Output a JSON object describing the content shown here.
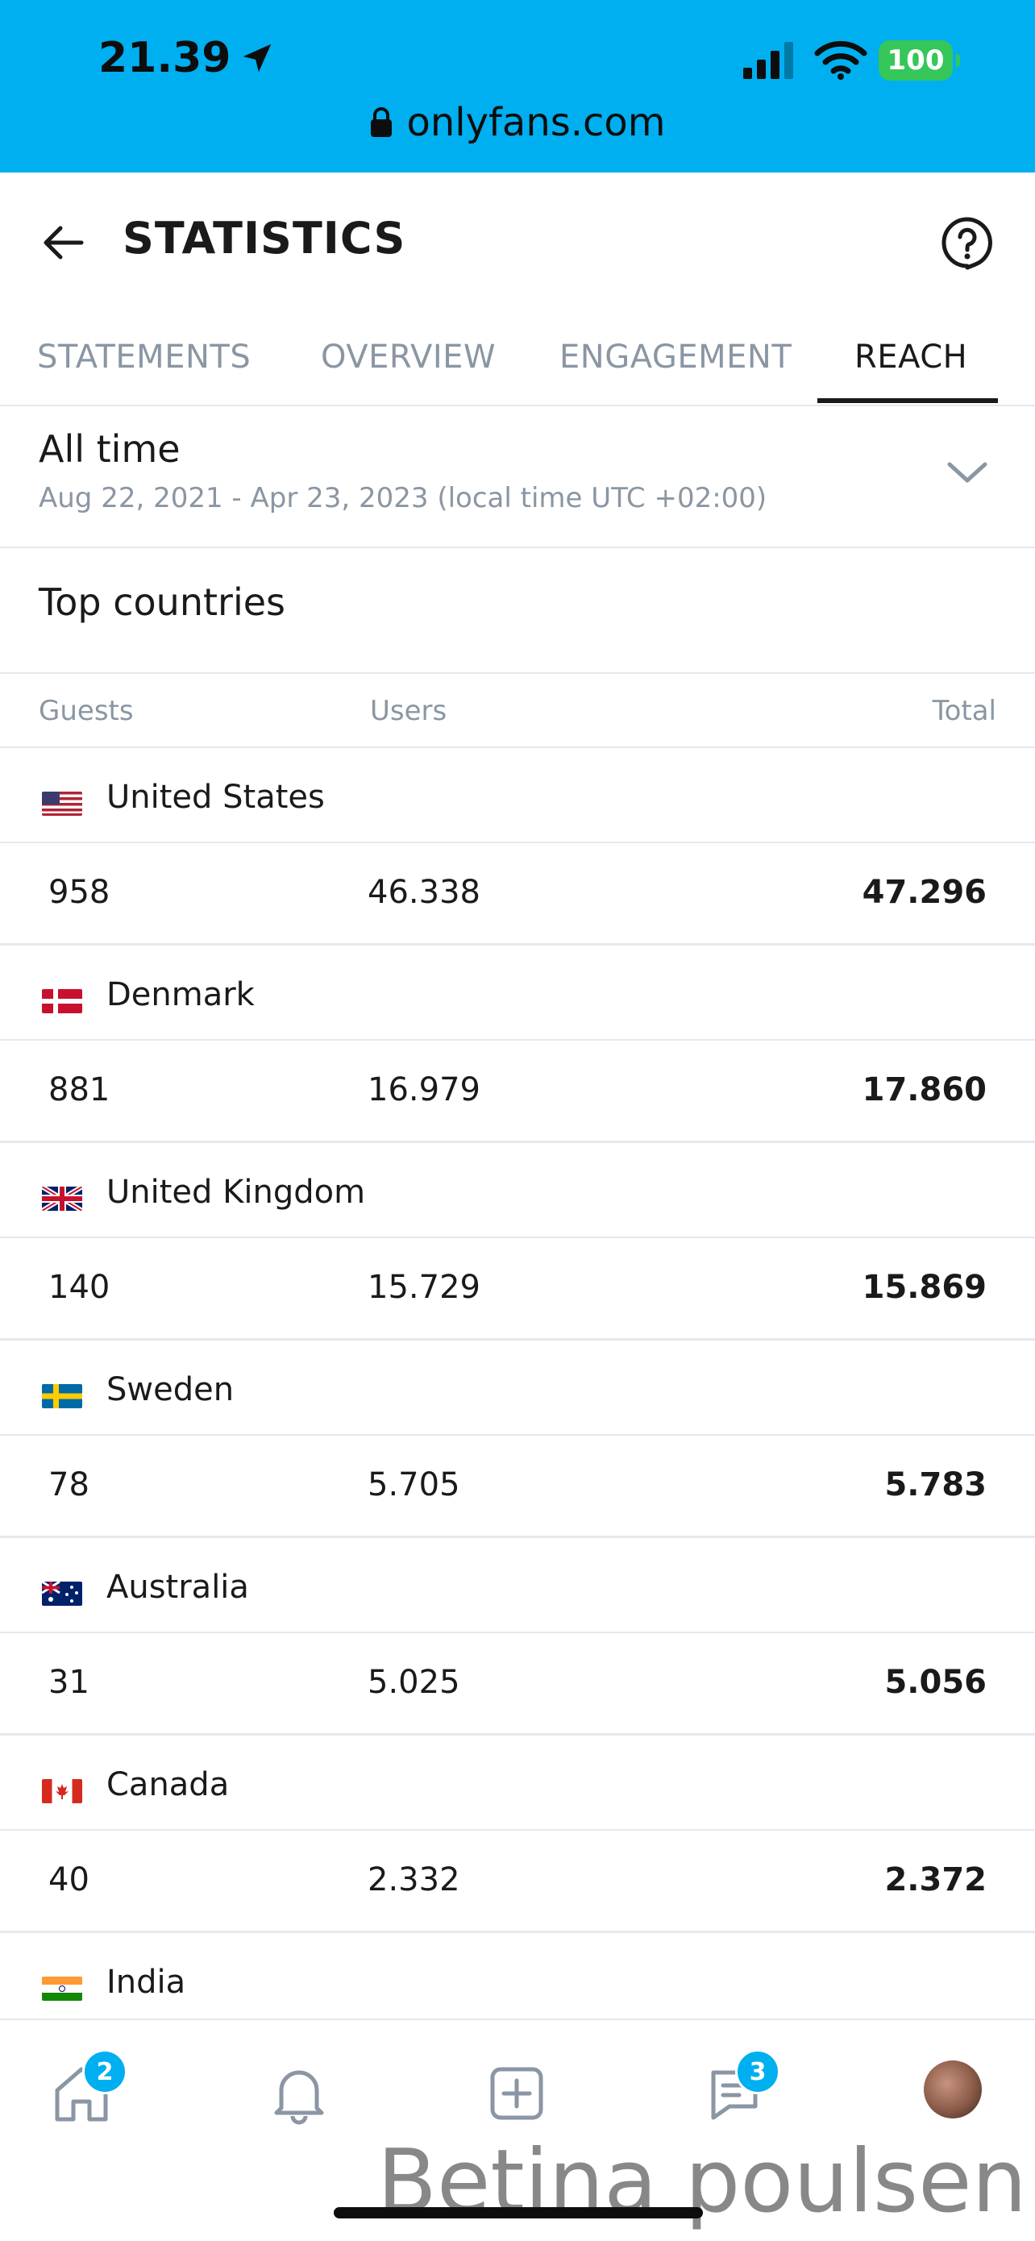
{
  "status_bar": {
    "time": "21.39",
    "battery": "100",
    "url": "onlyfans.com"
  },
  "header": {
    "title": "STATISTICS"
  },
  "tabs": [
    {
      "label": "STATEMENTS",
      "active": false
    },
    {
      "label": "OVERVIEW",
      "active": false
    },
    {
      "label": "ENGAGEMENT",
      "active": false
    },
    {
      "label": "REACH",
      "active": true
    }
  ],
  "date_range": {
    "label": "All time",
    "dates": "Aug 22, 2021 - Apr 23, 2023 (local time UTC +02:00)"
  },
  "section": {
    "title": "Top countries",
    "columns": [
      "Guests",
      "Users",
      "Total"
    ]
  },
  "countries": [
    {
      "name": "United States",
      "guests": "958",
      "users": "46.338",
      "total": "47.296"
    },
    {
      "name": "Denmark",
      "guests": "881",
      "users": "16.979",
      "total": "17.860"
    },
    {
      "name": "United Kingdom",
      "guests": "140",
      "users": "15.729",
      "total": "15.869"
    },
    {
      "name": "Sweden",
      "guests": "78",
      "users": "5.705",
      "total": "5.783"
    },
    {
      "name": "Australia",
      "guests": "31",
      "users": "5.025",
      "total": "5.056"
    },
    {
      "name": "Canada",
      "guests": "40",
      "users": "2.332",
      "total": "2.372"
    },
    {
      "name": "India",
      "guests": "",
      "users": "",
      "total": ""
    }
  ],
  "bottom_nav": {
    "home_badge": "2",
    "messages_badge": "3",
    "icons": [
      "home-icon",
      "bell-icon",
      "add-post-icon",
      "messages-icon",
      "avatar"
    ]
  },
  "colors": {
    "brand": "#00AFF0",
    "muted": "#8a96a3",
    "divider": "#e6e8eb",
    "battery": "#35c759"
  },
  "watermark": "Betina poulsen"
}
